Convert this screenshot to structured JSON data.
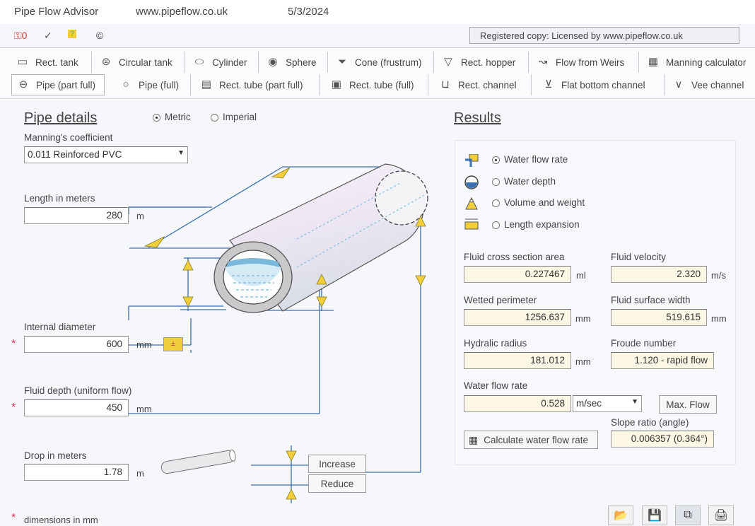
{
  "titlebar": {
    "app": "Pipe Flow Advisor",
    "url": "www.pipeflow.co.uk",
    "date": "5/3/2024"
  },
  "iconbar": {
    "license": "Registered copy: Licensed by www.pipeflow.co.uk",
    "copyright": "©"
  },
  "toolbar": {
    "row1": [
      "Rect. tank",
      "Circular tank",
      "Cylinder",
      "Sphere",
      "Cone (frustrum)",
      "Rect. hopper",
      "Flow from Weirs",
      "Manning calculator"
    ],
    "row2": [
      "Pipe (part full)",
      "Pipe (full)",
      "Rect. tube (part full)",
      "Rect. tube (full)",
      "Rect. channel",
      "Flat bottom channel",
      "Vee channel"
    ]
  },
  "pipe_details": {
    "heading": "Pipe details",
    "metric": "Metric",
    "imperial": "Imperial",
    "manning_label": "Manning's coefficient",
    "manning_value": "0.011  Reinforced PVC",
    "length_label": "Length  in meters",
    "length_value": "280",
    "length_unit": "m",
    "diameter_label": "Internal diameter",
    "diameter_value": "600",
    "diameter_unit": "mm",
    "depth_label": "Fluid depth (uniform flow)",
    "depth_value": "450",
    "depth_unit": "mm",
    "drop_label": "Drop  in meters",
    "drop_value": "1.78",
    "drop_unit": "m",
    "increase": "Increase",
    "reduce": "Reduce",
    "footnote_star": "*",
    "footnote": "dimensions in mm"
  },
  "results": {
    "heading": "Results",
    "options": [
      "Water flow rate",
      "Water depth",
      "Volume and weight",
      "Length expansion"
    ],
    "selected_option": 0,
    "cross_area_label": "Fluid cross section area",
    "cross_area_value": "0.227467",
    "cross_area_unit": "ml",
    "velocity_label": "Fluid velocity",
    "velocity_value": "2.320",
    "velocity_unit": "m/s",
    "wetted_label": "Wetted perimeter",
    "wetted_value": "1256.637",
    "wetted_unit": "mm",
    "surface_label": "Fluid surface width",
    "surface_value": "519.615",
    "surface_unit": "mm",
    "hydraulic_label": "Hydralic radius",
    "hydraulic_value": "181.012",
    "hydraulic_unit": "mm",
    "froude_label": "Froude number",
    "froude_value": "1.120 - rapid flow",
    "flow_label": "Water flow rate",
    "flow_value": "0.528",
    "flow_unit": "m/sec",
    "max_flow": "Max. Flow",
    "slope_label": "Slope ratio (angle)",
    "slope_value": "0.006357 (0.364°)",
    "calc_button": "Calculate water flow rate"
  },
  "colors": {
    "accent_yellow": "#f1cf3a",
    "water_blue": "#7ab8dc",
    "results_field": "#fbf7e4",
    "star": "#d03a5a"
  }
}
